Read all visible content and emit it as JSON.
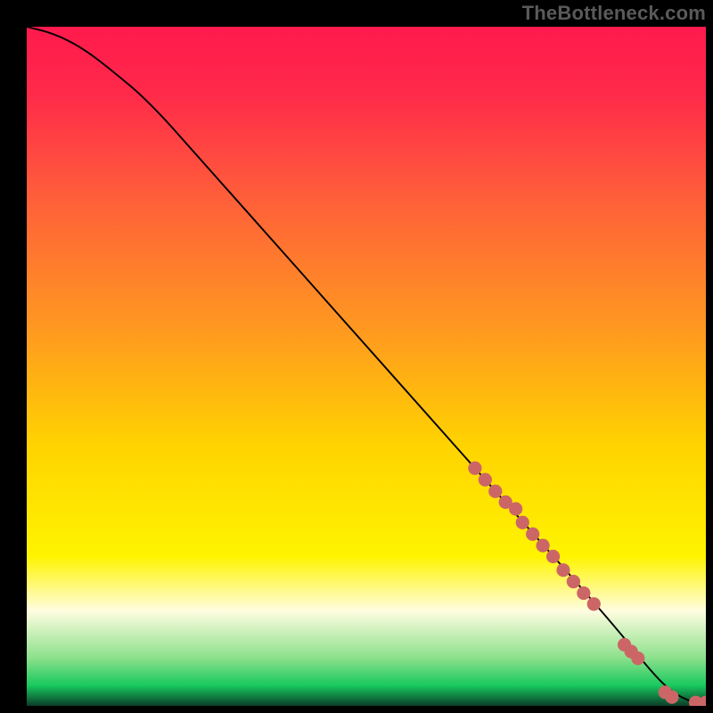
{
  "watermark": "TheBottleneck.com",
  "colors": {
    "frame": "#000000",
    "watermark": "#5a5a5a",
    "dots": "#cc6666",
    "line": "#000000",
    "gradient_stops": [
      {
        "offset": 0.0,
        "color": "#ff1a4d"
      },
      {
        "offset": 0.1,
        "color": "#ff2a4a"
      },
      {
        "offset": 0.25,
        "color": "#ff5e3a"
      },
      {
        "offset": 0.45,
        "color": "#ff9a1f"
      },
      {
        "offset": 0.62,
        "color": "#ffd400"
      },
      {
        "offset": 0.78,
        "color": "#fff400"
      },
      {
        "offset": 0.86,
        "color": "#fffde0"
      },
      {
        "offset": 0.93,
        "color": "#8be08b"
      },
      {
        "offset": 0.97,
        "color": "#18c95e"
      },
      {
        "offset": 1.0,
        "color": "#0a3d28"
      }
    ]
  },
  "chart_data": {
    "type": "line",
    "title": "",
    "xlabel": "",
    "ylabel": "",
    "xlim": [
      0,
      100
    ],
    "ylim": [
      0,
      100
    ],
    "series": [
      {
        "name": "curve",
        "x": [
          0,
          4,
          8,
          12,
          18,
          26,
          34,
          42,
          50,
          58,
          66,
          74,
          82,
          88,
          92,
          95,
          98,
          100
        ],
        "y": [
          100,
          99,
          97,
          94,
          89,
          80,
          71,
          62,
          53,
          44,
          35,
          26,
          17,
          10,
          5,
          2,
          0.5,
          0.5
        ]
      }
    ],
    "dots": [
      {
        "x": 66,
        "y": 35
      },
      {
        "x": 67.5,
        "y": 33.3
      },
      {
        "x": 69,
        "y": 31.6
      },
      {
        "x": 70.5,
        "y": 30
      },
      {
        "x": 72,
        "y": 29
      },
      {
        "x": 73,
        "y": 27
      },
      {
        "x": 74.5,
        "y": 25.3
      },
      {
        "x": 76,
        "y": 23.6
      },
      {
        "x": 77.5,
        "y": 22
      },
      {
        "x": 79,
        "y": 20
      },
      {
        "x": 80.5,
        "y": 18.3
      },
      {
        "x": 82,
        "y": 16.6
      },
      {
        "x": 83.5,
        "y": 15
      },
      {
        "x": 88,
        "y": 9
      },
      {
        "x": 89,
        "y": 8
      },
      {
        "x": 90,
        "y": 7
      },
      {
        "x": 94,
        "y": 2
      },
      {
        "x": 95,
        "y": 1.3
      },
      {
        "x": 98.5,
        "y": 0.5
      },
      {
        "x": 100,
        "y": 0.5
      }
    ]
  }
}
